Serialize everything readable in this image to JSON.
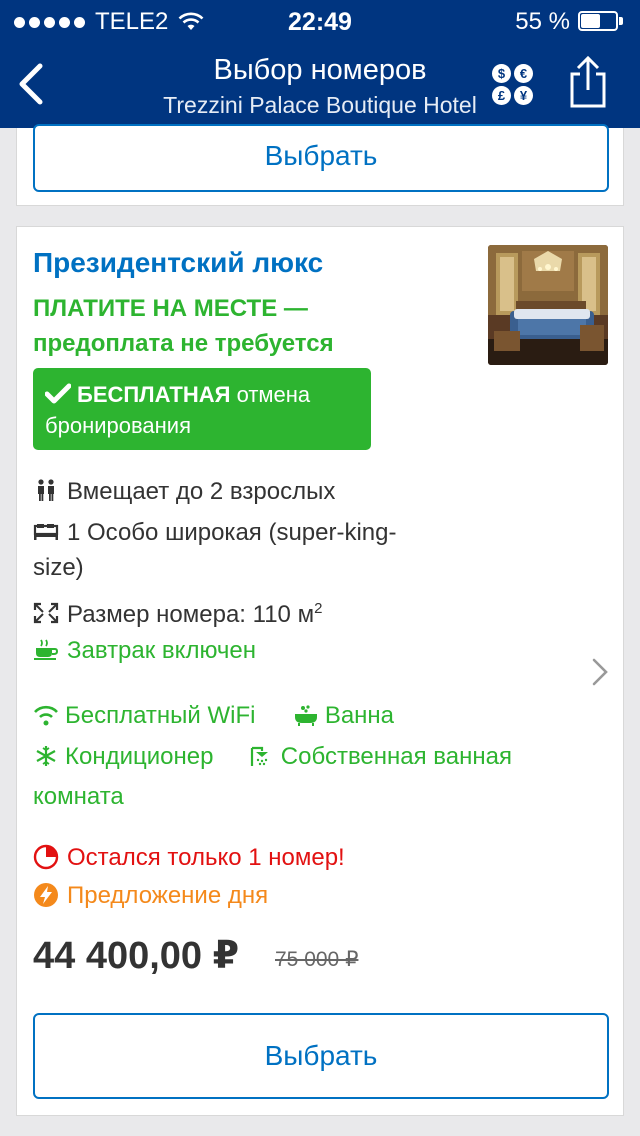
{
  "status_bar": {
    "carrier": "TELE2",
    "time": "22:49",
    "battery": "55 %",
    "battery_level": 0.55
  },
  "nav": {
    "title": "Выбор номеров",
    "subtitle": "Trezzini Palace Boutique Hotel",
    "currency_symbols": [
      "$",
      "€",
      "£",
      "¥"
    ]
  },
  "prev_card": {
    "select_label": "Выбрать"
  },
  "room": {
    "name": "Президентский люкс",
    "pay_note_line1": "ПЛАТИТЕ НА МЕСТЕ —",
    "pay_note_line2": "предоплата не требуется",
    "free_cancel_bold": "БЕСПЛАТНАЯ",
    "free_cancel_rest": " отмена",
    "free_cancel_line2": "бронирования",
    "features": {
      "capacity": "Вмещает до 2 взрослых",
      "bed_line1": "1 Особо широкая (super-king-",
      "bed_line2": "size)",
      "size_text": "Размер номера: 110 м",
      "size_sup": "2",
      "breakfast": "Завтрак включен"
    },
    "amenities": {
      "wifi": "Бесплатный WiFi",
      "bath": "Ванна",
      "ac": "Кондиционер",
      "bathroom_line1": "Собственная ванная",
      "bathroom_line2": "комната"
    },
    "only_left": "Остался только 1 номер!",
    "deal": "Предложение дня",
    "price": "44 400,00 ₽",
    "old_price": "75 000 ₽",
    "select_label": "Выбрать"
  },
  "colors": {
    "brand_blue": "#003580",
    "link_blue": "#0071c2",
    "green": "#2db430",
    "red": "#e21111",
    "orange": "#f4891b"
  },
  "icons": {
    "back": "chevron-left-icon",
    "currency": "currency-icon",
    "share": "share-icon",
    "capacity": "people-icon",
    "bed": "bed-icon",
    "size": "expand-icon",
    "breakfast": "coffee-cup-icon",
    "wifi": "wifi-icon",
    "bath": "bathtub-icon",
    "ac": "snowflake-icon",
    "bathroom": "shower-icon",
    "only_left": "pie-clock-icon",
    "deal": "lightning-icon",
    "check": "checkmark-icon"
  }
}
